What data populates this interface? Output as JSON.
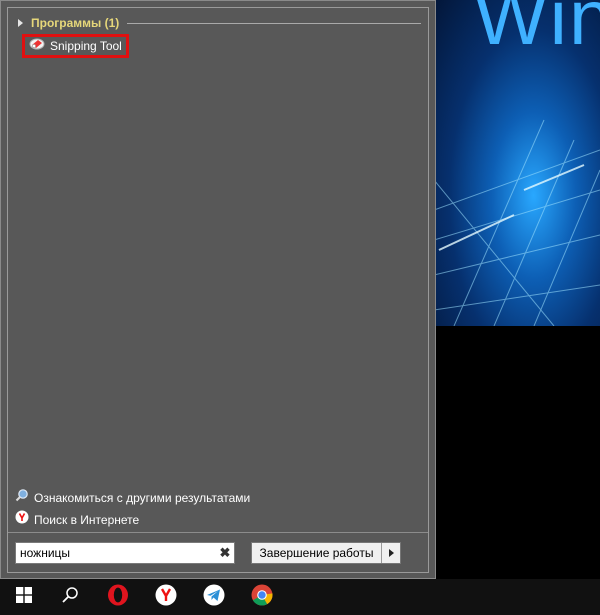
{
  "start_menu": {
    "group": {
      "title": "Программы (1)"
    },
    "results": [
      {
        "label": "Snipping Tool",
        "icon": "snipping-tool-icon"
      }
    ],
    "links": {
      "more_results": "Ознакомиться с другими результатами",
      "web_search": "Поиск в Интернете"
    },
    "search": {
      "value": "ножницы"
    },
    "shutdown": {
      "label": "Завершение работы"
    }
  },
  "wallpaper": {
    "text": "Win"
  },
  "taskbar": {
    "items": [
      {
        "icon": "windows-start-icon"
      },
      {
        "icon": "search-icon"
      },
      {
        "icon": "opera-icon"
      },
      {
        "icon": "yandex-browser-icon"
      },
      {
        "icon": "telegram-icon"
      },
      {
        "icon": "chrome-icon"
      }
    ]
  },
  "colors": {
    "menu_bg": "#585858",
    "group_title": "#e6d77a",
    "highlight": "#e01010",
    "wallpaper_blue": "#29a8ff"
  }
}
